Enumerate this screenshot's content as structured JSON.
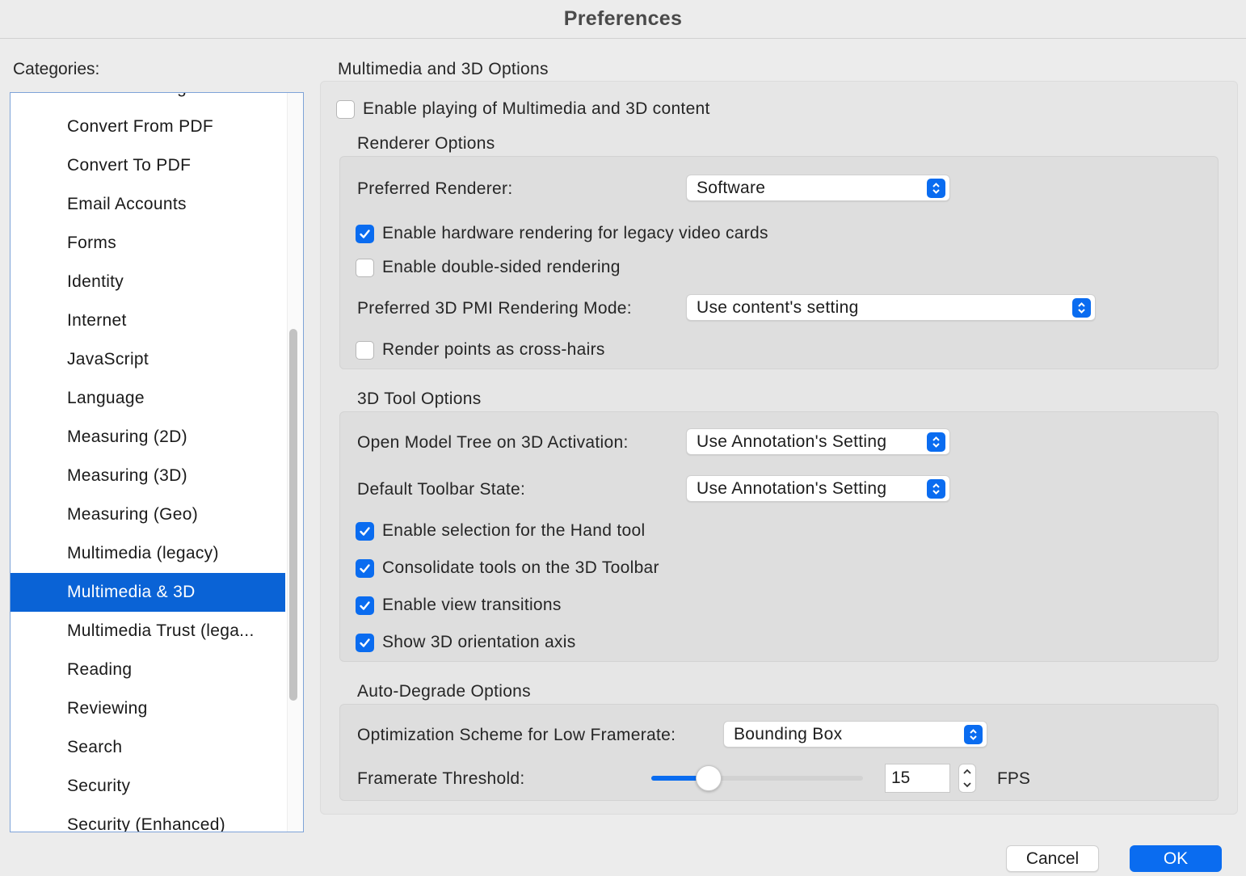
{
  "window": {
    "title": "Preferences"
  },
  "sidebar": {
    "label": "Categories:",
    "items": [
      {
        "label": "Content Editing",
        "selected": false
      },
      {
        "label": "Convert From PDF",
        "selected": false
      },
      {
        "label": "Convert To PDF",
        "selected": false
      },
      {
        "label": "Email Accounts",
        "selected": false
      },
      {
        "label": "Forms",
        "selected": false
      },
      {
        "label": "Identity",
        "selected": false
      },
      {
        "label": "Internet",
        "selected": false
      },
      {
        "label": "JavaScript",
        "selected": false
      },
      {
        "label": "Language",
        "selected": false
      },
      {
        "label": "Measuring (2D)",
        "selected": false
      },
      {
        "label": "Measuring (3D)",
        "selected": false
      },
      {
        "label": "Measuring (Geo)",
        "selected": false
      },
      {
        "label": "Multimedia (legacy)",
        "selected": false
      },
      {
        "label": "Multimedia & 3D",
        "selected": true
      },
      {
        "label": "Multimedia Trust (lega...",
        "selected": false
      },
      {
        "label": "Reading",
        "selected": false
      },
      {
        "label": "Reviewing",
        "selected": false
      },
      {
        "label": "Search",
        "selected": false
      },
      {
        "label": "Security",
        "selected": false
      },
      {
        "label": "Security (Enhanced)",
        "selected": false
      }
    ]
  },
  "main": {
    "title": "Multimedia and 3D Options",
    "enable_playing": {
      "label": "Enable playing of Multimedia and 3D content",
      "checked": false
    },
    "renderer": {
      "title": "Renderer Options",
      "preferred_renderer_label": "Preferred Renderer:",
      "preferred_renderer_value": "Software",
      "hw_legacy": {
        "label": "Enable hardware rendering for legacy video cards",
        "checked": true
      },
      "double_sided": {
        "label": "Enable double-sided rendering",
        "checked": false
      },
      "pmi_label": "Preferred 3D PMI Rendering Mode:",
      "pmi_value": "Use content's setting",
      "cross_hairs": {
        "label": "Render points as cross-hairs",
        "checked": false
      }
    },
    "tool": {
      "title": "3D Tool Options",
      "model_tree_label": "Open Model Tree on 3D Activation:",
      "model_tree_value": "Use Annotation's Setting",
      "toolbar_state_label": "Default Toolbar State:",
      "toolbar_state_value": "Use Annotation's Setting",
      "hand_tool": {
        "label": "Enable selection for the Hand tool",
        "checked": true
      },
      "consolidate": {
        "label": "Consolidate tools on the 3D Toolbar",
        "checked": true
      },
      "view_transitions": {
        "label": "Enable view transitions",
        "checked": true
      },
      "orientation_axis": {
        "label": "Show 3D orientation axis",
        "checked": true
      }
    },
    "degrade": {
      "title": "Auto-Degrade Options",
      "scheme_label": "Optimization Scheme for Low Framerate:",
      "scheme_value": "Bounding Box",
      "threshold_label": "Framerate Threshold:",
      "threshold_value": "15",
      "threshold_slider_fraction": 0.27,
      "unit": "FPS"
    }
  },
  "buttons": {
    "cancel": "Cancel",
    "ok": "OK"
  },
  "colors": {
    "accent": "#0a6cf0",
    "selection": "#0a63d6"
  }
}
